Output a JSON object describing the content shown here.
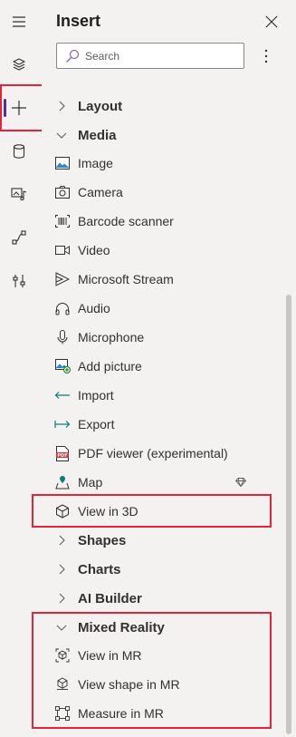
{
  "header": {
    "title": "Insert",
    "search_placeholder": "Search"
  },
  "rail": {
    "items": [
      "menu-icon",
      "tree-view-icon",
      "insert-icon",
      "data-icon",
      "media-icon",
      "power-automate-icon",
      "tools-icon"
    ],
    "active": "insert-icon"
  },
  "categories": {
    "layout": "Layout",
    "media": "Media",
    "shapes": "Shapes",
    "charts": "Charts",
    "ai_builder": "AI Builder",
    "mixed_reality": "Mixed Reality"
  },
  "media_items": [
    {
      "label": "Image",
      "icon": "image-icon"
    },
    {
      "label": "Camera",
      "icon": "camera-icon"
    },
    {
      "label": "Barcode scanner",
      "icon": "barcode-icon"
    },
    {
      "label": "Video",
      "icon": "video-icon"
    },
    {
      "label": "Microsoft Stream",
      "icon": "stream-icon"
    },
    {
      "label": "Audio",
      "icon": "headphones-icon"
    },
    {
      "label": "Microphone",
      "icon": "microphone-icon"
    },
    {
      "label": "Add picture",
      "icon": "add-picture-icon"
    },
    {
      "label": "Import",
      "icon": "import-icon"
    },
    {
      "label": "Export",
      "icon": "export-icon"
    },
    {
      "label": "PDF viewer (experimental)",
      "icon": "pdf-icon"
    },
    {
      "label": "Map",
      "icon": "map-pin-icon",
      "premium": true
    },
    {
      "label": "View in 3D",
      "icon": "cube-icon"
    }
  ],
  "mixed_reality_items": [
    {
      "label": "View in MR",
      "icon": "view-mr-icon"
    },
    {
      "label": "View shape in MR",
      "icon": "view-shape-mr-icon"
    },
    {
      "label": "Measure in MR",
      "icon": "measure-mr-icon"
    }
  ],
  "colors": {
    "highlight": "#e3243a",
    "active_indicator": "#5c2d91",
    "background": "#f3f2f1",
    "map_icon": "#0f7b78",
    "pdf_icon": "#d13438",
    "icon_blue": "#2b88d8"
  }
}
